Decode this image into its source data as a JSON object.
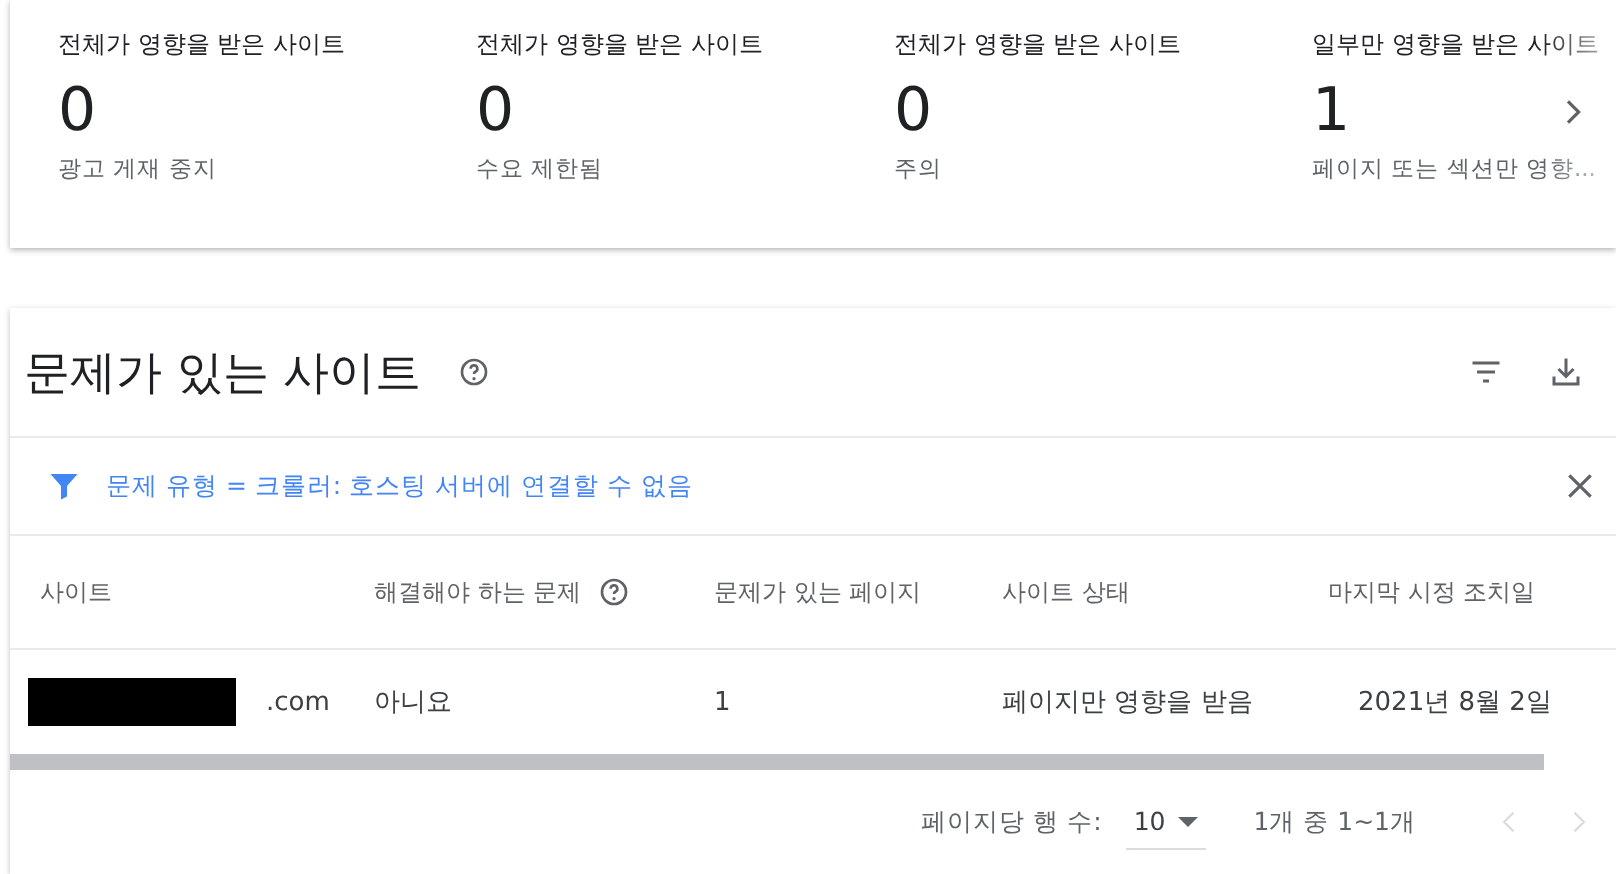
{
  "summary_cards": [
    {
      "title": "전체가 영향을 받은 사이트",
      "count": "0",
      "subtitle": "광고 게재 중지",
      "faded": false
    },
    {
      "title": "전체가 영향을 받은 사이트",
      "count": "0",
      "subtitle": "수요 제한됨",
      "faded": false
    },
    {
      "title": "전체가 영향을 받은 사이트",
      "count": "0",
      "subtitle": "주의",
      "faded": false
    },
    {
      "title": "일부만 영향을 받은 사이트",
      "count": "1",
      "subtitle": "페이지 또는 섹션만 영향...",
      "faded": true
    }
  ],
  "panel": {
    "title": "문제가 있는 사이트",
    "filter": "문제 유형 = 크롤러: 호스팅 서버에 연결할 수 없음",
    "table": {
      "columns": [
        {
          "label": "사이트",
          "help": false
        },
        {
          "label": "해결해야 하는 문제",
          "help": true
        },
        {
          "label": "문제가 있는 페이지",
          "help": false
        },
        {
          "label": "사이트 상태",
          "help": false
        },
        {
          "label": "마지막 시정 조치일",
          "help": false
        }
      ],
      "rows": [
        {
          "redacted": true,
          "cells": [
            ".com",
            "아니요",
            "1",
            "페이지만 영향을 받음",
            "2021년 8월 2일"
          ]
        }
      ]
    },
    "pagination": {
      "rows_label": "페이지당 행 수:",
      "rows_per_page": "10",
      "range": "1개 중 1~1개",
      "prev_disabled": true,
      "next_disabled": true
    }
  }
}
